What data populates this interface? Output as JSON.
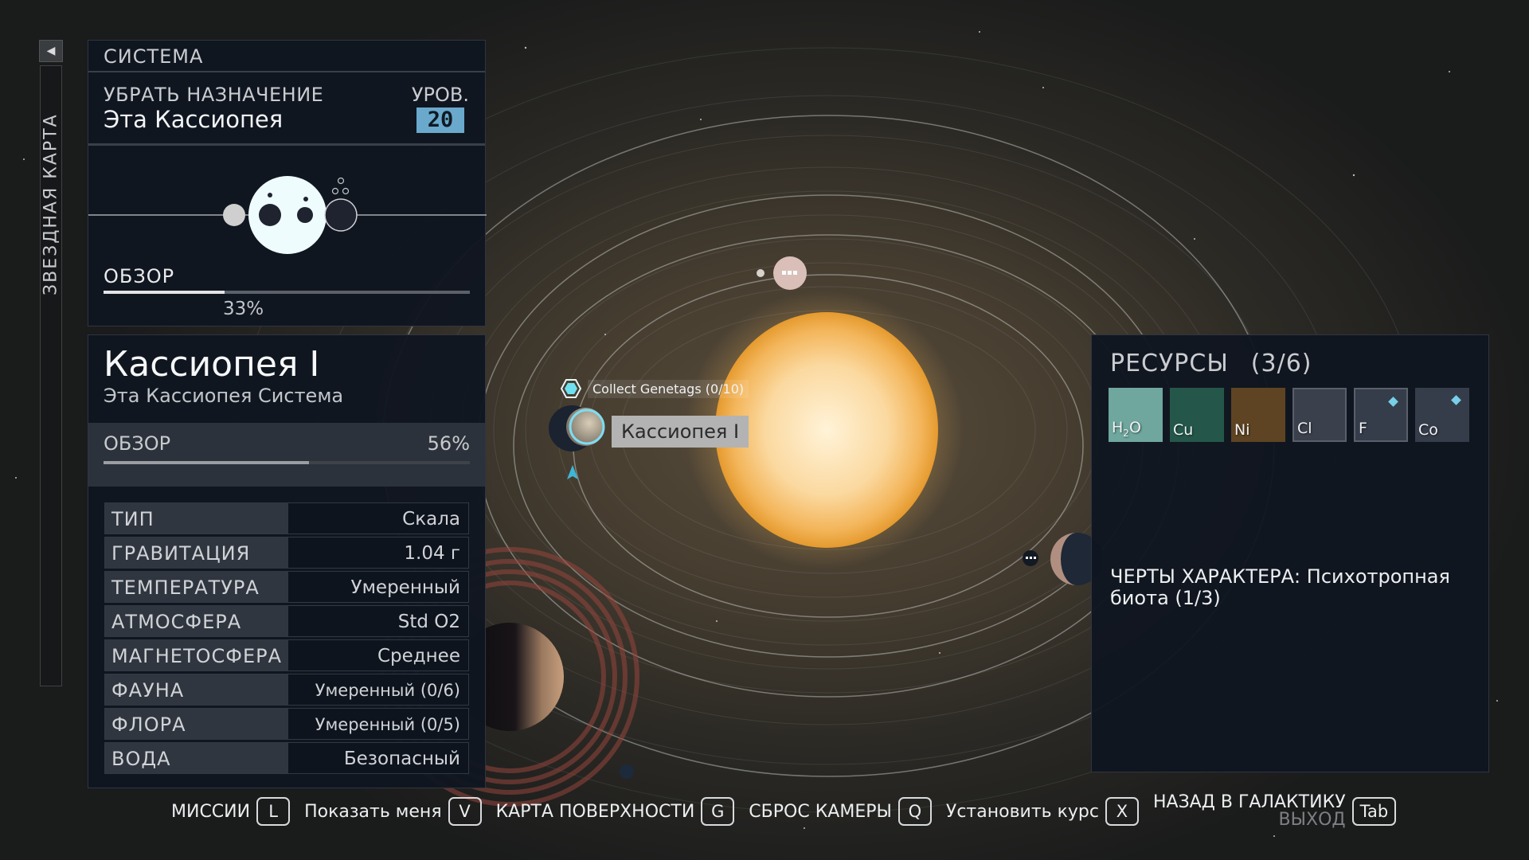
{
  "rail": {
    "collapse_icon": "chevron-left-icon",
    "label": "ЗВЕЗДНАЯ КАРТА"
  },
  "system_panel": {
    "header": "СИСТЕМА",
    "target_action": "УБРАТЬ НАЗНАЧЕНИЕ",
    "target_name": "Эта Кассиопея",
    "level_label": "УРОВ.",
    "level_value": "20",
    "survey_label": "ОБЗОР",
    "survey_percent": 33,
    "survey_text": "33%"
  },
  "planet_panel": {
    "name": "Кассиопея I",
    "system": "Эта Кассиопея Система",
    "survey_label": "ОБЗОР",
    "survey_percent": 56,
    "survey_text": "56%",
    "traits": [
      {
        "key": "ТИП",
        "value": "Скала"
      },
      {
        "key": "ГРАВИТАЦИЯ",
        "value": "1.04 г"
      },
      {
        "key": "ТЕМПЕРАТУРА",
        "value": "Умеренный"
      },
      {
        "key": "АТМОСФЕРА",
        "value": "Std O2"
      },
      {
        "key": "МАГНЕТОСФЕРА",
        "value": "Среднее"
      },
      {
        "key": "ФАУНА",
        "value": "Умеренный (0/6)"
      },
      {
        "key": "ФЛОРА",
        "value": "Умеренный (0/5)"
      },
      {
        "key": "ВОДА",
        "value": "Безопасный"
      }
    ]
  },
  "resources_panel": {
    "title": "РЕСУРСЫ",
    "count": "(3/6)",
    "resources": [
      {
        "symbol": "H2O",
        "color": "#6fa79e",
        "marked": false
      },
      {
        "symbol": "Cu",
        "color": "#24574a",
        "marked": false
      },
      {
        "symbol": "Ni",
        "color": "#5e4422",
        "marked": false
      },
      {
        "symbol": "Cl",
        "color": "#3b414c",
        "marked": false
      },
      {
        "symbol": "F",
        "color": "#363d4a",
        "marked": true
      },
      {
        "symbol": "Co",
        "color": "#363d4a",
        "marked": true
      }
    ],
    "traits_text": "ЧЕРТЫ ХАРАКТЕРА: Психотропная биота (1/3)"
  },
  "map": {
    "mission_icon": "mission-hexagon-icon",
    "mission_text": "Collect Genetags (0/10)",
    "selected_planet_label": "Кассиопея I",
    "player_ship_icon": "ship-marker-icon"
  },
  "keybar": [
    {
      "label": "МИССИИ",
      "key": "L"
    },
    {
      "label": "Показать меня",
      "key": "V"
    },
    {
      "label": "КАРТА ПОВЕРХНОСТИ",
      "key": "G"
    },
    {
      "label": "СБРОС КАМЕРЫ",
      "key": "Q"
    },
    {
      "label": "Установить курс",
      "key": "X"
    },
    {
      "label": "НАЗАД В ГАЛАКТИКУ",
      "sublabel": "ВЫХОД",
      "key": "Tab"
    }
  ],
  "colors": {
    "accent": "#6aa9cc",
    "mission_cyan": "#6fe0f0",
    "panel_bg": "#101620"
  }
}
